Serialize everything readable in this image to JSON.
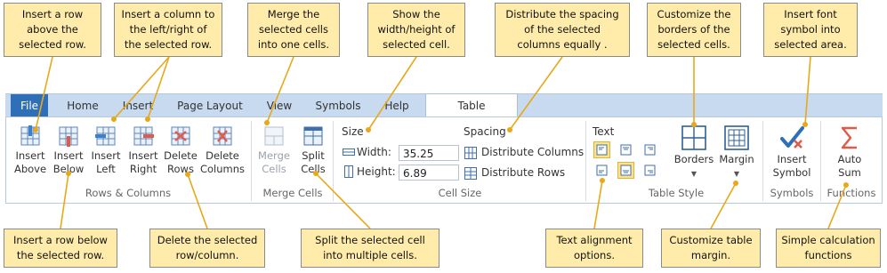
{
  "tabs": [
    "File",
    "Home",
    "Insert",
    "Page Layout",
    "View",
    "Symbols",
    "Help",
    "Table"
  ],
  "active_tab": "Table",
  "groups": {
    "rows_columns": {
      "label": "Rows & Columns",
      "buttons": [
        "Insert\nAbove",
        "Insert\nBelow",
        "Insert\nLeft",
        "Insert\nRight",
        "Delete\nRows",
        "Delete\nColumns"
      ]
    },
    "merge_cells": {
      "label": "Merge Cells",
      "merge": "Merge\nCells",
      "split": "Split\nCells"
    },
    "cell_size": {
      "label": "Cell Size",
      "size_heading": "Size",
      "width_label": "Width:",
      "width_value": "35.25",
      "height_label": "Height:",
      "height_value": "6.89",
      "spacing_heading": "Spacing",
      "distribute_columns": "Distribute Columns",
      "distribute_rows": "Distribute Rows"
    },
    "table_style": {
      "label": "Table Style",
      "text_heading": "Text",
      "borders": "Borders",
      "margin": "Margin"
    },
    "symbols": {
      "label": "Symbols",
      "insert_symbol": "Insert\nSymbol"
    },
    "functions": {
      "label": "Functions",
      "auto_sum": "Auto\nSum"
    }
  },
  "callouts": {
    "insert_above": "Insert a row\nabove the\nselected row.",
    "insert_column": "Insert a column to\nthe left/right of\nthe selected row.",
    "merge": "Merge the\nselected cells\ninto one cells.",
    "show_size": "Show the\nwidth/height of\nselected cell.",
    "distribute": "Distribute the spacing\nof the selected\ncolumns equally .",
    "borders": "Customize the\nborders of the\nselected cells.",
    "insert_symbol": "Insert font\nsymbol into\nselected area.",
    "insert_below": "Insert a row below\nthe selected row.",
    "delete": "Delete the selected\nrow/column.",
    "split": "Split the selected cell\ninto multiple cells.",
    "text_alignment": "Text alignment\noptions.",
    "margin": "Customize table\nmargin.",
    "calculation": "Simple calculation\nfunctions"
  },
  "colors": {
    "accent": "#2f6fb8",
    "callout_bg": "#ffecaa",
    "leader": "#e8a818",
    "tab_bar": "#c8daef",
    "icon_red": "#e05a4a"
  }
}
